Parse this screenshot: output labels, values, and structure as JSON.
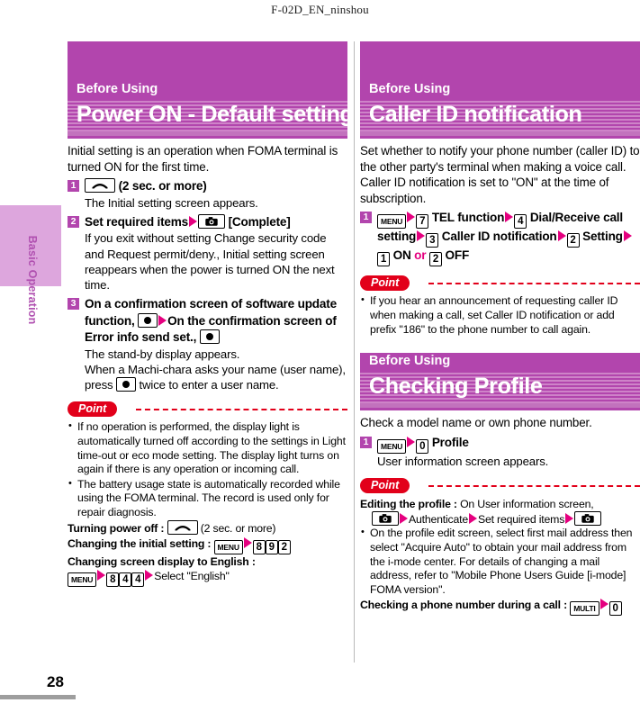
{
  "running_head": "F-02D_EN_ninshou",
  "page_number": "28",
  "edge_tab_label": "Basic Operation",
  "colors": {
    "header_purple": "#b245ad",
    "tab_light_purple": "#dda6dd",
    "arrow_magenta": "#e5007f",
    "point_red": "#e2001a"
  },
  "left_column": {
    "section": {
      "kicker": "Before Using",
      "title": "Power ON - Default setting"
    },
    "intro": "Initial setting is an operation when FOMA terminal is turned ON for the first time.",
    "steps": [
      {
        "num": "1",
        "head_parts": [
          {
            "type": "key",
            "style": "power",
            "label": "power-key"
          },
          {
            "type": "text",
            "text": " (2 sec. or more)"
          }
        ],
        "desc": "The Initial setting screen appears."
      },
      {
        "num": "2",
        "head_parts": [
          {
            "type": "text",
            "text": "Set required items"
          },
          {
            "type": "arrow"
          },
          {
            "type": "key",
            "style": "camera",
            "label": "camera-key"
          },
          {
            "type": "text",
            "text": " [Complete]"
          }
        ],
        "desc": "If you exit without setting Change security code and Request permit/deny., Initial setting screen reappears when the power is turned ON the next time."
      },
      {
        "num": "3",
        "head_parts": [
          {
            "type": "text",
            "text": "On a confirmation screen of software update function, "
          },
          {
            "type": "key",
            "style": "center",
            "label": "center-key"
          },
          {
            "type": "arrow"
          },
          {
            "type": "text",
            "text": "On the confirmation screen of Error info send set., "
          },
          {
            "type": "key",
            "style": "center",
            "label": "center-key"
          }
        ],
        "desc": "The stand-by display appears.",
        "desc2": "When a Machi-chara asks your name (user name), press",
        "desc3": "twice to enter a user name."
      }
    ],
    "point": {
      "label": "Point",
      "bullets": [
        "If no operation is performed, the display light is automatically turned off according to the settings in Light time-out or eco mode setting. The display light turns on again if there is any operation or incoming call.",
        "The battery usage state is automatically recorded while using the FOMA terminal. The record is used only for repair diagnosis."
      ],
      "lines": [
        {
          "label": "Turning power off :",
          "keys": [
            "power"
          ],
          "suffix": " (2 sec. or more)"
        },
        {
          "label": "Changing the initial setting :",
          "keys": [
            "MENU",
            "arrow",
            "8",
            "9",
            "2"
          ],
          "suffix": ""
        },
        {
          "label": "Changing screen display to English :",
          "keys": [],
          "suffix": ""
        },
        {
          "label": "",
          "keys": [
            "MENU",
            "arrow",
            "8",
            "4",
            "4",
            "arrow"
          ],
          "suffix": "Select \"English\""
        }
      ]
    }
  },
  "right_column": {
    "section1": {
      "kicker": "Before Using",
      "title": "Caller ID notification"
    },
    "intro1": "Set whether to notify your phone number (caller ID) to the other party's terminal when making a voice call. Caller ID notification is set to \"ON\" at the time of subscription.",
    "step1": {
      "num": "1",
      "sequence": [
        {
          "type": "key",
          "style": "word",
          "text": "MENU"
        },
        {
          "type": "arrow"
        },
        {
          "type": "key",
          "style": "num",
          "text": "7"
        },
        {
          "type": "text",
          "text": "TEL function"
        },
        {
          "type": "arrow"
        },
        {
          "type": "key",
          "style": "num",
          "text": "4"
        },
        {
          "type": "text",
          "text": "Dial/Receive call setting"
        },
        {
          "type": "arrow"
        },
        {
          "type": "key",
          "style": "num",
          "text": "3"
        },
        {
          "type": "text",
          "text": "Caller ID notification"
        },
        {
          "type": "arrow"
        },
        {
          "type": "key",
          "style": "num",
          "text": "2"
        },
        {
          "type": "text",
          "text": "Setting"
        },
        {
          "type": "arrow"
        },
        {
          "type": "key",
          "style": "num",
          "text": "1"
        },
        {
          "type": "text",
          "text": "ON "
        },
        {
          "type": "or"
        },
        {
          "type": "key",
          "style": "num",
          "text": "2"
        },
        {
          "type": "text",
          "text": "OFF"
        }
      ]
    },
    "point1": {
      "label": "Point",
      "bullets": [
        "If you hear an announcement of requesting caller ID when making a call, set Caller ID notification or add prefix \"186\" to the phone number to call again."
      ]
    },
    "section2": {
      "kicker": "Before Using",
      "title": "Checking Profile"
    },
    "intro2": "Check a model name or own phone number.",
    "step2": {
      "num": "1",
      "sequence": [
        {
          "type": "key",
          "style": "word",
          "text": "MENU"
        },
        {
          "type": "arrow"
        },
        {
          "type": "key",
          "style": "num",
          "text": "0"
        },
        {
          "type": "text",
          "text": "Profile"
        }
      ],
      "desc": "User information screen appears."
    },
    "point2": {
      "label": "Point",
      "edit_label": "Editing the profile :",
      "edit_text": "On User information screen,",
      "edit_seq_text1": "Authenticate",
      "edit_seq_text2": "Set required items",
      "bullets": [
        "On the profile edit screen, select first mail address then select \"Acquire Auto\" to obtain your mail address from the i-mode center. For details of changing a mail address, refer to \"Mobile Phone Users Guide [i-mode] FOMA version\"."
      ],
      "check_label": "Checking a phone number during a call :",
      "check_keys": [
        "MULTI",
        "arrow",
        "0"
      ]
    }
  }
}
